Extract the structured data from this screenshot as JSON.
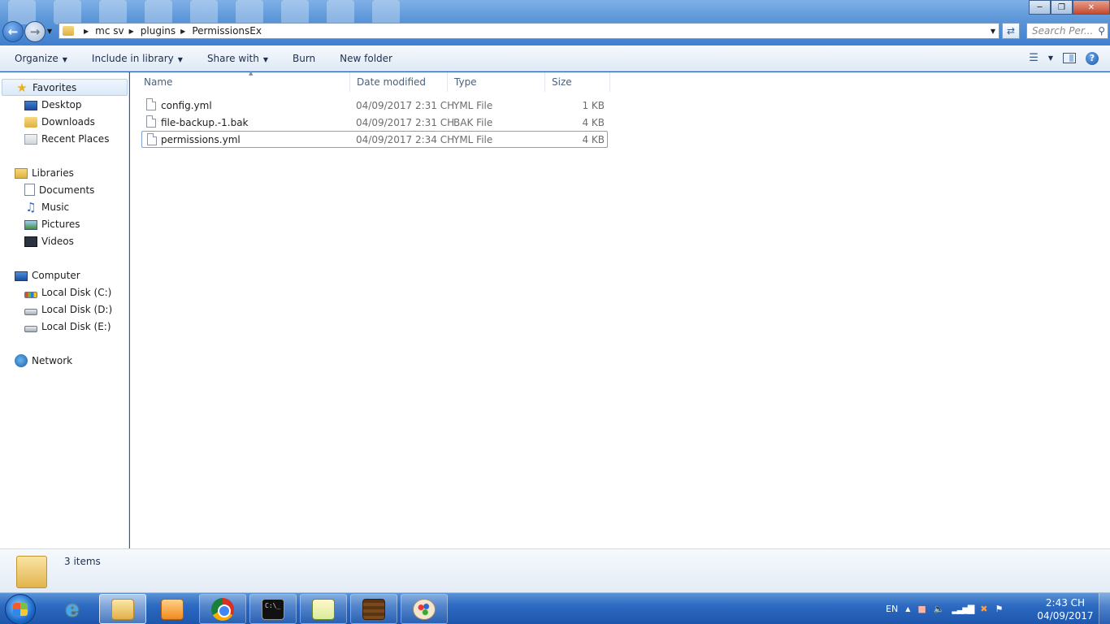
{
  "address": {
    "crumbs": [
      "mc sv",
      "plugins",
      "PermissionsEx"
    ],
    "search_placeholder": "Search Per..."
  },
  "toolbar": {
    "organize": "Organize",
    "include_in_library": "Include in library",
    "share_with": "Share with",
    "burn": "Burn",
    "new_folder": "New folder"
  },
  "navigation": {
    "favorites": {
      "label": "Favorites",
      "items": [
        "Desktop",
        "Downloads",
        "Recent Places"
      ]
    },
    "libraries": {
      "label": "Libraries",
      "items": [
        "Documents",
        "Music",
        "Pictures",
        "Videos"
      ]
    },
    "computer": {
      "label": "Computer",
      "items": [
        "Local Disk (C:)",
        "Local Disk (D:)",
        "Local Disk (E:)"
      ]
    },
    "network": {
      "label": "Network"
    }
  },
  "file_list": {
    "columns": [
      "Name",
      "Date modified",
      "Type",
      "Size"
    ],
    "rows": [
      {
        "name": "config.yml",
        "date": "04/09/2017 2:31 CH",
        "type": "YML File",
        "size": "1 KB"
      },
      {
        "name": "file-backup.-1.bak",
        "date": "04/09/2017 2:31 CH",
        "type": "BAK File",
        "size": "4 KB"
      },
      {
        "name": "permissions.yml",
        "date": "04/09/2017 2:34 CH",
        "type": "YML File",
        "size": "4 KB"
      }
    ],
    "selected_row": "permissions.yml"
  },
  "details": {
    "item_count": "3 items"
  },
  "taskbar": {
    "apps": [
      "Internet Explorer",
      "Windows Explorer",
      "Media Player",
      "Google Chrome",
      "Command Prompt",
      "Notepad++",
      "Minecraft",
      "Paint"
    ],
    "language": "EN",
    "time": "2:43 CH",
    "date": "04/09/2017"
  }
}
